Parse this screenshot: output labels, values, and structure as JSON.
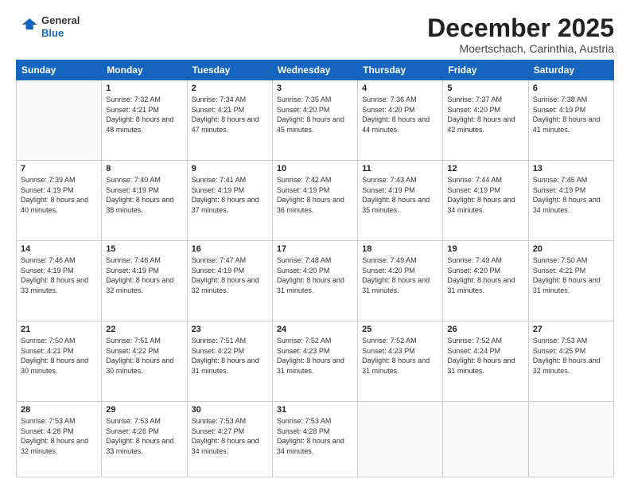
{
  "header": {
    "logo": {
      "general": "General",
      "blue": "Blue"
    },
    "title": "December 2025",
    "location": "Moertschach, Carinthia, Austria"
  },
  "weekdays": [
    "Sunday",
    "Monday",
    "Tuesday",
    "Wednesday",
    "Thursday",
    "Friday",
    "Saturday"
  ],
  "weeks": [
    [
      {
        "day": "",
        "sunrise": "",
        "sunset": "",
        "daylight": ""
      },
      {
        "day": "1",
        "sunrise": "Sunrise: 7:32 AM",
        "sunset": "Sunset: 4:21 PM",
        "daylight": "Daylight: 8 hours and 48 minutes."
      },
      {
        "day": "2",
        "sunrise": "Sunrise: 7:34 AM",
        "sunset": "Sunset: 4:21 PM",
        "daylight": "Daylight: 8 hours and 47 minutes."
      },
      {
        "day": "3",
        "sunrise": "Sunrise: 7:35 AM",
        "sunset": "Sunset: 4:20 PM",
        "daylight": "Daylight: 8 hours and 45 minutes."
      },
      {
        "day": "4",
        "sunrise": "Sunrise: 7:36 AM",
        "sunset": "Sunset: 4:20 PM",
        "daylight": "Daylight: 8 hours and 44 minutes."
      },
      {
        "day": "5",
        "sunrise": "Sunrise: 7:37 AM",
        "sunset": "Sunset: 4:20 PM",
        "daylight": "Daylight: 8 hours and 42 minutes."
      },
      {
        "day": "6",
        "sunrise": "Sunrise: 7:38 AM",
        "sunset": "Sunset: 4:19 PM",
        "daylight": "Daylight: 8 hours and 41 minutes."
      }
    ],
    [
      {
        "day": "7",
        "sunrise": "Sunrise: 7:39 AM",
        "sunset": "Sunset: 4:19 PM",
        "daylight": "Daylight: 8 hours and 40 minutes."
      },
      {
        "day": "8",
        "sunrise": "Sunrise: 7:40 AM",
        "sunset": "Sunset: 4:19 PM",
        "daylight": "Daylight: 8 hours and 38 minutes."
      },
      {
        "day": "9",
        "sunrise": "Sunrise: 7:41 AM",
        "sunset": "Sunset: 4:19 PM",
        "daylight": "Daylight: 8 hours and 37 minutes."
      },
      {
        "day": "10",
        "sunrise": "Sunrise: 7:42 AM",
        "sunset": "Sunset: 4:19 PM",
        "daylight": "Daylight: 8 hours and 36 minutes."
      },
      {
        "day": "11",
        "sunrise": "Sunrise: 7:43 AM",
        "sunset": "Sunset: 4:19 PM",
        "daylight": "Daylight: 8 hours and 35 minutes."
      },
      {
        "day": "12",
        "sunrise": "Sunrise: 7:44 AM",
        "sunset": "Sunset: 4:19 PM",
        "daylight": "Daylight: 8 hours and 34 minutes."
      },
      {
        "day": "13",
        "sunrise": "Sunrise: 7:45 AM",
        "sunset": "Sunset: 4:19 PM",
        "daylight": "Daylight: 8 hours and 34 minutes."
      }
    ],
    [
      {
        "day": "14",
        "sunrise": "Sunrise: 7:46 AM",
        "sunset": "Sunset: 4:19 PM",
        "daylight": "Daylight: 8 hours and 33 minutes."
      },
      {
        "day": "15",
        "sunrise": "Sunrise: 7:46 AM",
        "sunset": "Sunset: 4:19 PM",
        "daylight": "Daylight: 8 hours and 32 minutes."
      },
      {
        "day": "16",
        "sunrise": "Sunrise: 7:47 AM",
        "sunset": "Sunset: 4:19 PM",
        "daylight": "Daylight: 8 hours and 32 minutes."
      },
      {
        "day": "17",
        "sunrise": "Sunrise: 7:48 AM",
        "sunset": "Sunset: 4:20 PM",
        "daylight": "Daylight: 8 hours and 31 minutes."
      },
      {
        "day": "18",
        "sunrise": "Sunrise: 7:49 AM",
        "sunset": "Sunset: 4:20 PM",
        "daylight": "Daylight: 8 hours and 31 minutes."
      },
      {
        "day": "19",
        "sunrise": "Sunrise: 7:49 AM",
        "sunset": "Sunset: 4:20 PM",
        "daylight": "Daylight: 8 hours and 31 minutes."
      },
      {
        "day": "20",
        "sunrise": "Sunrise: 7:50 AM",
        "sunset": "Sunset: 4:21 PM",
        "daylight": "Daylight: 8 hours and 31 minutes."
      }
    ],
    [
      {
        "day": "21",
        "sunrise": "Sunrise: 7:50 AM",
        "sunset": "Sunset: 4:21 PM",
        "daylight": "Daylight: 8 hours and 30 minutes."
      },
      {
        "day": "22",
        "sunrise": "Sunrise: 7:51 AM",
        "sunset": "Sunset: 4:22 PM",
        "daylight": "Daylight: 8 hours and 30 minutes."
      },
      {
        "day": "23",
        "sunrise": "Sunrise: 7:51 AM",
        "sunset": "Sunset: 4:22 PM",
        "daylight": "Daylight: 8 hours and 31 minutes."
      },
      {
        "day": "24",
        "sunrise": "Sunrise: 7:52 AM",
        "sunset": "Sunset: 4:23 PM",
        "daylight": "Daylight: 8 hours and 31 minutes."
      },
      {
        "day": "25",
        "sunrise": "Sunrise: 7:52 AM",
        "sunset": "Sunset: 4:23 PM",
        "daylight": "Daylight: 8 hours and 31 minutes."
      },
      {
        "day": "26",
        "sunrise": "Sunrise: 7:52 AM",
        "sunset": "Sunset: 4:24 PM",
        "daylight": "Daylight: 8 hours and 31 minutes."
      },
      {
        "day": "27",
        "sunrise": "Sunrise: 7:53 AM",
        "sunset": "Sunset: 4:25 PM",
        "daylight": "Daylight: 8 hours and 32 minutes."
      }
    ],
    [
      {
        "day": "28",
        "sunrise": "Sunrise: 7:53 AM",
        "sunset": "Sunset: 4:26 PM",
        "daylight": "Daylight: 8 hours and 32 minutes."
      },
      {
        "day": "29",
        "sunrise": "Sunrise: 7:53 AM",
        "sunset": "Sunset: 4:26 PM",
        "daylight": "Daylight: 8 hours and 33 minutes."
      },
      {
        "day": "30",
        "sunrise": "Sunrise: 7:53 AM",
        "sunset": "Sunset: 4:27 PM",
        "daylight": "Daylight: 8 hours and 34 minutes."
      },
      {
        "day": "31",
        "sunrise": "Sunrise: 7:53 AM",
        "sunset": "Sunset: 4:28 PM",
        "daylight": "Daylight: 8 hours and 34 minutes."
      },
      {
        "day": "",
        "sunrise": "",
        "sunset": "",
        "daylight": ""
      },
      {
        "day": "",
        "sunrise": "",
        "sunset": "",
        "daylight": ""
      },
      {
        "day": "",
        "sunrise": "",
        "sunset": "",
        "daylight": ""
      }
    ]
  ],
  "colors": {
    "header_bg": "#1565c0",
    "header_text": "#ffffff",
    "border": "#cccccc"
  }
}
